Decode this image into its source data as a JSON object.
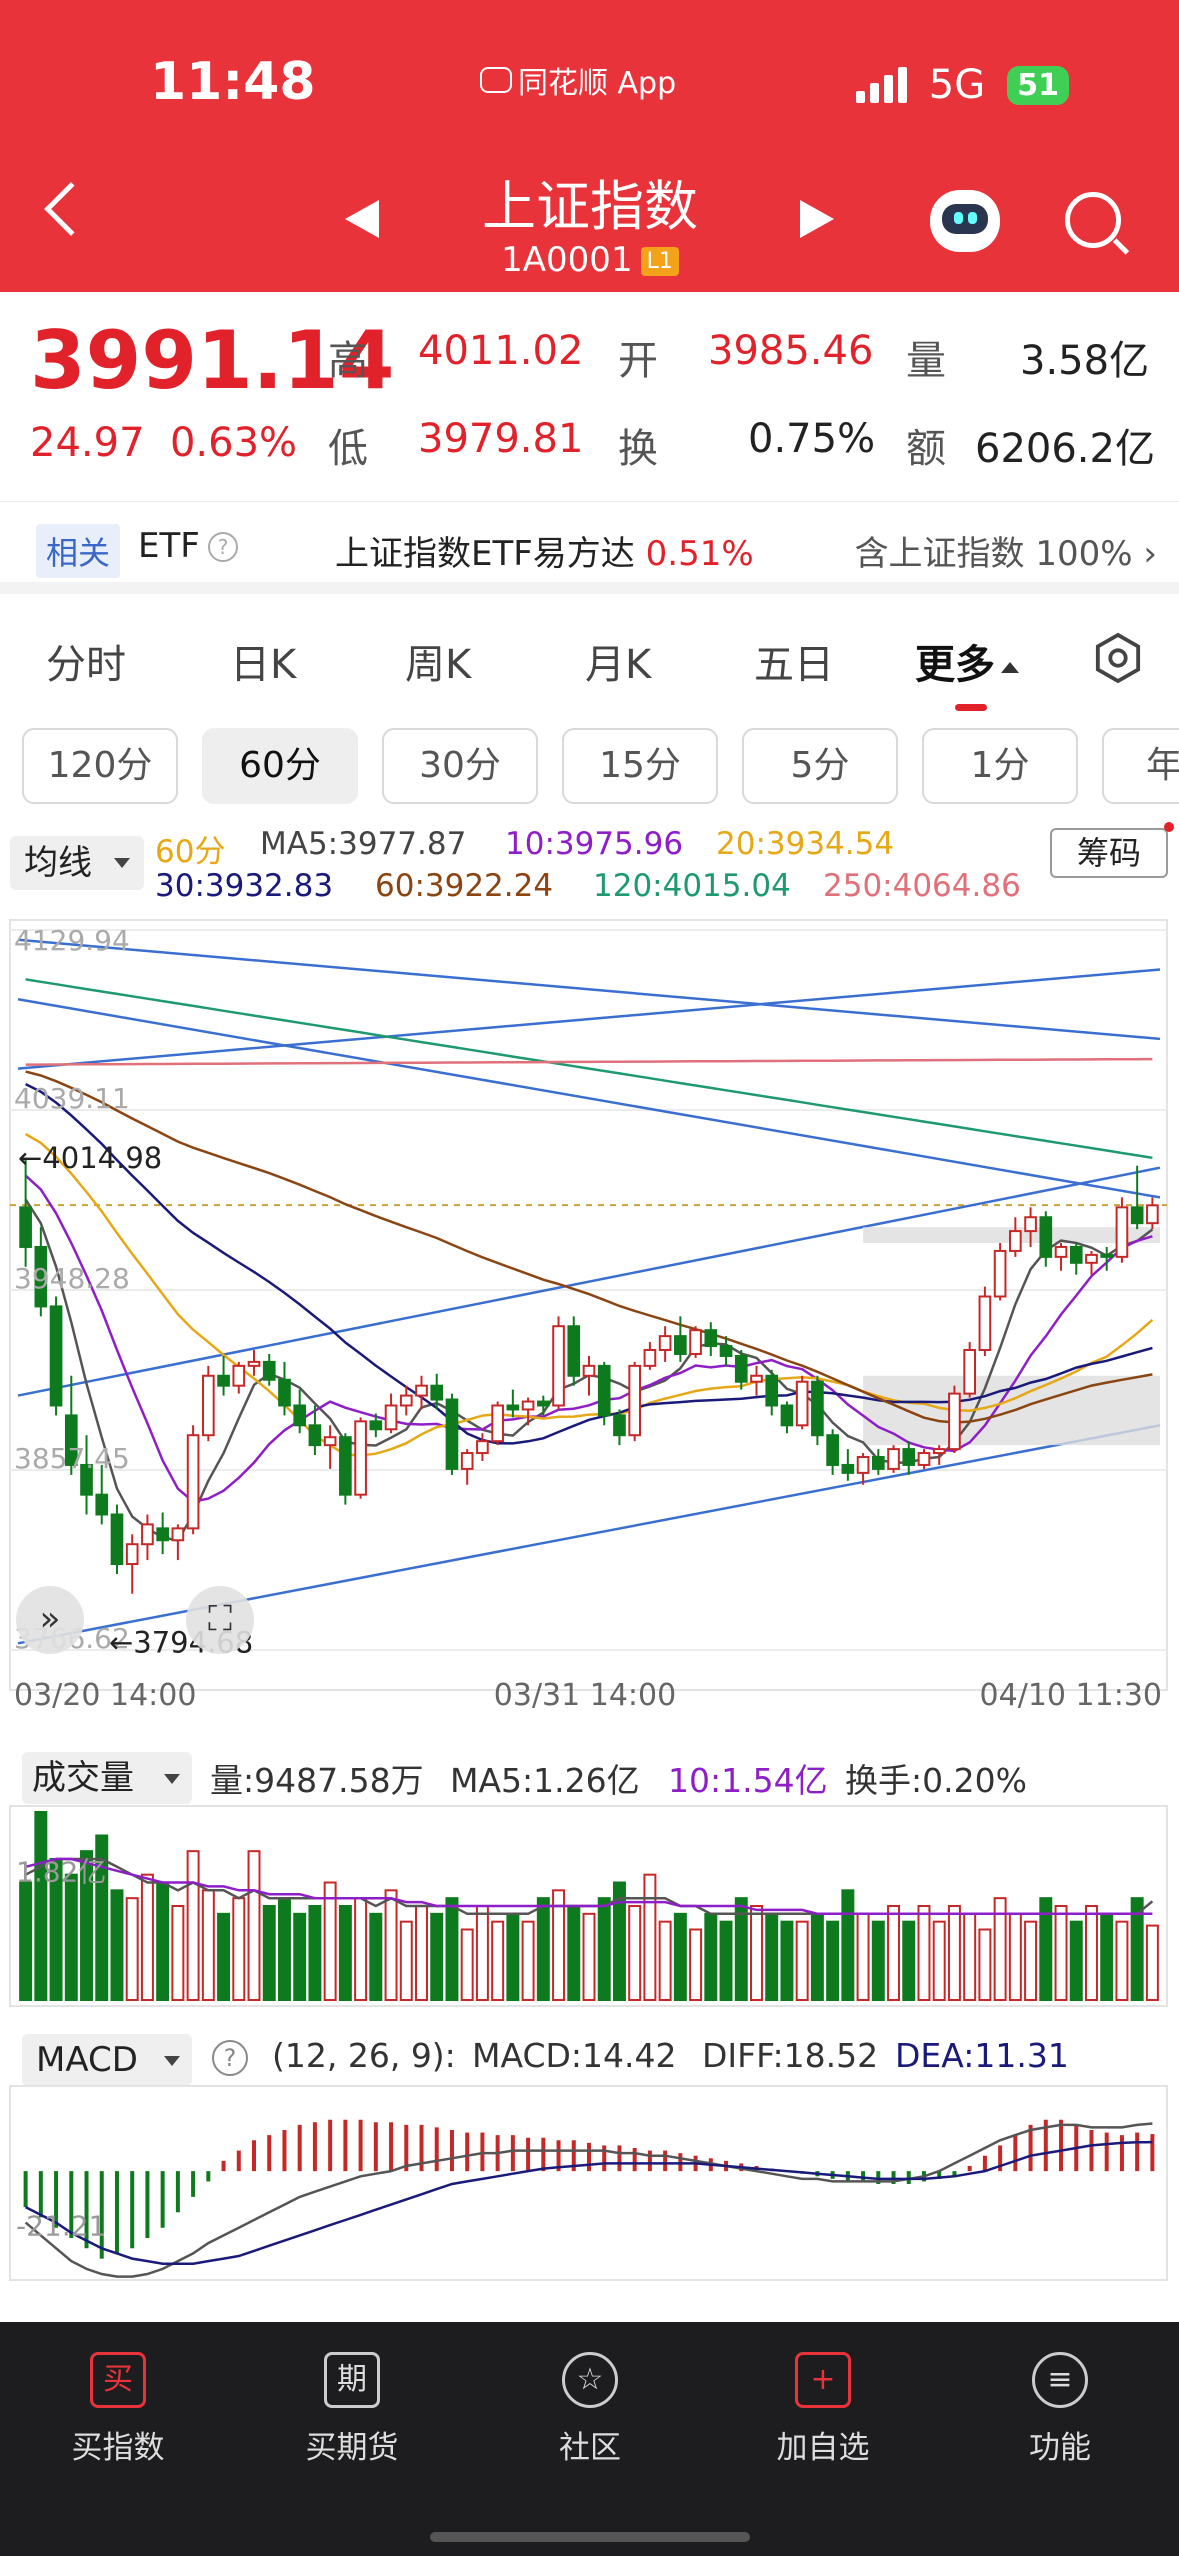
{
  "status_bar": {
    "time": "11:48",
    "app": "同花顺 App",
    "network": "5G",
    "battery": "51"
  },
  "header": {
    "title": "上证指数",
    "code": "1A0001",
    "badge": "L1"
  },
  "quote": {
    "price": "3991.14",
    "change": "24.97",
    "change_pct": "0.63%",
    "high_label": "高",
    "high": "4011.02",
    "open_label": "开",
    "open": "3985.46",
    "volume_label": "量",
    "volume": "3.58亿",
    "low_label": "低",
    "low": "3979.81",
    "turnover_label": "换",
    "turnover": "0.75%",
    "amount_label": "额",
    "amount": "6206.2亿"
  },
  "etf": {
    "tag": "相关",
    "name": "ETF",
    "fund": "上证指数ETF易方达",
    "fund_change": "0.51%",
    "holding": "含上证指数 100%",
    "chevron": "›"
  },
  "tabs": [
    {
      "label": "分时"
    },
    {
      "label": "日K"
    },
    {
      "label": "周K"
    },
    {
      "label": "月K"
    },
    {
      "label": "五日"
    },
    {
      "label": "更多"
    }
  ],
  "periods": [
    "120分",
    "60分",
    "30分",
    "15分",
    "5分",
    "1分",
    "年"
  ],
  "ma_legend": {
    "selector": "均线",
    "period": "60分",
    "ma5": "MA5:3977.87",
    "ma10": "10:3975.96",
    "ma20": "20:3934.54",
    "ma30": "30:3932.83",
    "ma60": "60:3922.24",
    "ma120": "120:4015.04",
    "ma250": "250:4064.86",
    "chips_button": "筹码"
  },
  "colors": {
    "up": "#c62828",
    "down": "#0e7a1e",
    "ma5": "#555555",
    "ma10": "#8e1fc8",
    "ma20": "#e6a817",
    "ma30": "#1a1a7a",
    "ma60": "#8b4513",
    "ma120": "#1e9a6e",
    "ma250": "#e0707a",
    "trend": "#3a6fd1"
  },
  "chart_data": [
    {
      "type": "candlestick",
      "ylim": [
        3766.62,
        4129.94
      ],
      "y_ticks": [
        "4129.94",
        "4039.11",
        "3948.28",
        "3857.45",
        "3766.62"
      ],
      "x_ticks": [
        "03/20 14:00",
        "03/31 14:00",
        "04/10 11:30"
      ],
      "annotations": {
        "high": "←4014.98",
        "low": "←3794.68"
      },
      "last_close": 3991.14,
      "candles": [
        [
          3990,
          4015,
          3960,
          3970
        ],
        [
          3970,
          3980,
          3935,
          3940
        ],
        [
          3940,
          3945,
          3885,
          3890
        ],
        [
          3885,
          3905,
          3855,
          3860
        ],
        [
          3860,
          3875,
          3835,
          3845
        ],
        [
          3845,
          3860,
          3830,
          3835
        ],
        [
          3835,
          3840,
          3805,
          3810
        ],
        [
          3810,
          3825,
          3795,
          3820
        ],
        [
          3820,
          3835,
          3812,
          3830
        ],
        [
          3828,
          3836,
          3815,
          3822
        ],
        [
          3822,
          3830,
          3812,
          3828
        ],
        [
          3828,
          3880,
          3825,
          3875
        ],
        [
          3875,
          3910,
          3872,
          3905
        ],
        [
          3905,
          3915,
          3895,
          3900
        ],
        [
          3900,
          3912,
          3896,
          3910
        ],
        [
          3910,
          3918,
          3905,
          3912
        ],
        [
          3912,
          3916,
          3900,
          3903
        ],
        [
          3903,
          3912,
          3885,
          3890
        ],
        [
          3890,
          3898,
          3876,
          3880
        ],
        [
          3880,
          3890,
          3865,
          3870
        ],
        [
          3870,
          3880,
          3858,
          3874
        ],
        [
          3874,
          3876,
          3840,
          3845
        ],
        [
          3845,
          3884,
          3843,
          3882
        ],
        [
          3882,
          3886,
          3874,
          3878
        ],
        [
          3878,
          3896,
          3876,
          3890
        ],
        [
          3890,
          3900,
          3885,
          3895
        ],
        [
          3895,
          3905,
          3888,
          3900
        ],
        [
          3900,
          3906,
          3888,
          3893
        ],
        [
          3893,
          3896,
          3855,
          3858
        ],
        [
          3858,
          3868,
          3850,
          3866
        ],
        [
          3866,
          3876,
          3862,
          3872
        ],
        [
          3872,
          3892,
          3870,
          3890
        ],
        [
          3890,
          3898,
          3884,
          3888
        ],
        [
          3888,
          3894,
          3880,
          3892
        ],
        [
          3892,
          3895,
          3885,
          3890
        ],
        [
          3890,
          3935,
          3888,
          3930
        ],
        [
          3930,
          3935,
          3900,
          3905
        ],
        [
          3905,
          3915,
          3895,
          3910
        ],
        [
          3910,
          3912,
          3880,
          3885
        ],
        [
          3885,
          3888,
          3870,
          3875
        ],
        [
          3875,
          3912,
          3872,
          3910
        ],
        [
          3910,
          3922,
          3908,
          3918
        ],
        [
          3918,
          3930,
          3912,
          3925
        ],
        [
          3925,
          3935,
          3912,
          3916
        ],
        [
          3916,
          3930,
          3914,
          3928
        ],
        [
          3928,
          3932,
          3915,
          3920
        ],
        [
          3920,
          3925,
          3910,
          3915
        ],
        [
          3915,
          3918,
          3898,
          3902
        ],
        [
          3902,
          3910,
          3895,
          3905
        ],
        [
          3905,
          3908,
          3885,
          3890
        ],
        [
          3890,
          3892,
          3876,
          3880
        ],
        [
          3880,
          3905,
          3878,
          3902
        ],
        [
          3902,
          3905,
          3870,
          3875
        ],
        [
          3875,
          3878,
          3855,
          3860
        ],
        [
          3860,
          3868,
          3852,
          3856
        ],
        [
          3856,
          3866,
          3850,
          3864
        ],
        [
          3864,
          3868,
          3855,
          3858
        ],
        [
          3858,
          3870,
          3856,
          3868
        ],
        [
          3868,
          3872,
          3855,
          3860
        ],
        [
          3860,
          3868,
          3858,
          3866
        ],
        [
          3866,
          3870,
          3860,
          3868
        ],
        [
          3868,
          3900,
          3866,
          3896
        ],
        [
          3896,
          3922,
          3894,
          3918
        ],
        [
          3918,
          3950,
          3915,
          3945
        ],
        [
          3945,
          3972,
          3943,
          3968
        ],
        [
          3968,
          3985,
          3965,
          3978
        ],
        [
          3978,
          3990,
          3970,
          3985
        ],
        [
          3985,
          3988,
          3960,
          3965
        ],
        [
          3965,
          3972,
          3958,
          3970
        ],
        [
          3970,
          3972,
          3956,
          3962
        ],
        [
          3962,
          3968,
          3956,
          3966
        ],
        [
          3966,
          3970,
          3958,
          3965
        ],
        [
          3965,
          3995,
          3962,
          3990
        ],
        [
          3990,
          4011,
          3979,
          3982
        ],
        [
          3982,
          3995,
          3979,
          3991
        ]
      ]
    },
    {
      "type": "bar",
      "title": "成交量",
      "volume_label": "量:9487.58万",
      "ma5": [
        1.6,
        1.7,
        1.8,
        1.8,
        1.8,
        1.8,
        1.7,
        1.6,
        1.5,
        1.5,
        1.4,
        1.5,
        1.4,
        1.4,
        1.3,
        1.4,
        1.3,
        1.3,
        1.3,
        1.3,
        1.3,
        1.3,
        1.3,
        1.2,
        1.3,
        1.2,
        1.2,
        1.2,
        1.2,
        1.1,
        1.1,
        1.1,
        1.1,
        1.1,
        1.2,
        1.2,
        1.2,
        1.2,
        1.2,
        1.3,
        1.3,
        1.3,
        1.3,
        1.2,
        1.2,
        1.1,
        1.1,
        1.1,
        1.1,
        1.1,
        1.1,
        1.1,
        1.1,
        1.1,
        1.1,
        1.1,
        1.1,
        1.1,
        1.1,
        1.1,
        1.1,
        1.1,
        1.1,
        1.1,
        1.1,
        1.1,
        1.1,
        1.1,
        1.1,
        1.1,
        1.1,
        1.1,
        1.1,
        1.1,
        1.26
      ],
      "ma10": [
        1.7,
        1.75,
        1.8,
        1.8,
        1.75,
        1.7,
        1.65,
        1.6,
        1.55,
        1.5,
        1.5,
        1.5,
        1.45,
        1.45,
        1.4,
        1.4,
        1.35,
        1.35,
        1.35,
        1.3,
        1.3,
        1.3,
        1.3,
        1.3,
        1.3,
        1.25,
        1.25,
        1.2,
        1.2,
        1.2,
        1.2,
        1.2,
        1.2,
        1.2,
        1.2,
        1.2,
        1.2,
        1.2,
        1.2,
        1.25,
        1.25,
        1.25,
        1.25,
        1.2,
        1.2,
        1.2,
        1.2,
        1.2,
        1.15,
        1.15,
        1.15,
        1.15,
        1.1,
        1.1,
        1.1,
        1.1,
        1.1,
        1.1,
        1.1,
        1.1,
        1.1,
        1.1,
        1.1,
        1.1,
        1.1,
        1.1,
        1.1,
        1.1,
        1.1,
        1.1,
        1.1,
        1.1,
        1.1,
        1.1,
        1.1
      ],
      "turnover": "换手:0.20%",
      "y_tick": "1.82亿",
      "ylim": [
        0,
        2.4
      ],
      "values": [
        1.5,
        2.4,
        1.8,
        1.6,
        1.9,
        2.1,
        1.4,
        1.3,
        1.6,
        1.5,
        1.2,
        1.9,
        1.4,
        1.1,
        1.3,
        1.9,
        1.2,
        1.3,
        1.1,
        1.2,
        1.5,
        1.2,
        1.3,
        1.1,
        1.4,
        1.0,
        1.2,
        1.1,
        1.3,
        0.9,
        1.2,
        1.0,
        1.1,
        1.0,
        1.3,
        1.4,
        1.2,
        1.1,
        1.3,
        1.5,
        1.2,
        1.6,
        1.0,
        1.1,
        0.9,
        1.1,
        1.0,
        1.3,
        1.2,
        1.1,
        1.0,
        1.0,
        1.1,
        1.0,
        1.4,
        1.1,
        1.0,
        1.2,
        1.0,
        1.2,
        1.0,
        1.2,
        1.1,
        0.9,
        1.3,
        1.1,
        1.0,
        1.3,
        1.2,
        1.0,
        1.2,
        1.1,
        1.0,
        1.3,
        0.95
      ]
    },
    {
      "type": "bar",
      "title": "MACD",
      "params": "(12, 26, 9):",
      "macd": "MACD:14.42",
      "diff": [
        -20,
        -25,
        -30,
        -35,
        -38,
        -40,
        -41,
        -41,
        -40,
        -38,
        -35,
        -32,
        -28,
        -25,
        -22,
        -19,
        -16,
        -13,
        -10,
        -8,
        -6,
        -4,
        -2,
        -1,
        0,
        2,
        3,
        4,
        5,
        6,
        7,
        7,
        8,
        8,
        8,
        8,
        8,
        8,
        8,
        7,
        7,
        6,
        6,
        5,
        4,
        3,
        2,
        1,
        0,
        -1,
        -2,
        -3,
        -3,
        -4,
        -4,
        -4,
        -4,
        -4,
        -3,
        -2,
        0,
        3,
        6,
        9,
        12,
        14,
        16,
        17,
        18,
        18,
        17,
        17,
        17,
        18,
        18.52
      ],
      "dea": [
        -14,
        -17,
        -20,
        -24,
        -27,
        -30,
        -32,
        -34,
        -35,
        -36,
        -36,
        -36,
        -35,
        -34,
        -33,
        -31,
        -29,
        -27,
        -25,
        -23,
        -21,
        -19,
        -17,
        -15,
        -13,
        -11,
        -9,
        -7,
        -5,
        -4,
        -3,
        -2,
        -1,
        0,
        1,
        1.5,
        2,
        2.5,
        3,
        3,
        3,
        3,
        3,
        3,
        3,
        2.5,
        2,
        1.5,
        1,
        0.5,
        0,
        -0.5,
        -1,
        -1.5,
        -2,
        -2.5,
        -3,
        -3,
        -3,
        -3,
        -2.5,
        -2,
        -1,
        0,
        2,
        4,
        6,
        7,
        8,
        9,
        10,
        10.5,
        11,
        11.2,
        11.31
      ],
      "y_tick": "-21.21",
      "ylim": [
        -40,
        30
      ],
      "values": [
        -14,
        -18,
        -22,
        -26,
        -30,
        -34,
        -32,
        -30,
        -26,
        -22,
        -16,
        -10,
        -4,
        4,
        8,
        12,
        14,
        16,
        18,
        19,
        20,
        20,
        20,
        19,
        19,
        18,
        18,
        17,
        16,
        15,
        15,
        14,
        14,
        13,
        13,
        12,
        12,
        11,
        10,
        10,
        9,
        8,
        8,
        7,
        6,
        5,
        4,
        3,
        2,
        1,
        0,
        -1,
        -2,
        -3,
        -4,
        -4,
        -5,
        -5,
        -5,
        -4,
        -3,
        -2,
        2,
        6,
        10,
        14,
        18,
        20,
        20,
        18,
        16,
        15,
        14,
        15,
        14.42
      ]
    }
  ],
  "volume_header": {
    "selector": "成交量",
    "volume": "量:9487.58万",
    "ma5": "MA5:1.26亿",
    "ma10": "10:1.54亿",
    "turnover": "换手:0.20%"
  },
  "macd_header": {
    "selector": "MACD",
    "params": "(12, 26, 9):",
    "macd": "MACD:14.42",
    "diff": "DIFF:18.52",
    "dea": "DEA:11.31",
    "help": "?"
  },
  "bottom_nav": [
    {
      "label": "买指数",
      "icon": "买"
    },
    {
      "label": "买期货",
      "icon": "期"
    },
    {
      "label": "社区",
      "icon": "☆"
    },
    {
      "label": "加自选",
      "icon": "+"
    },
    {
      "label": "功能",
      "icon": "≡"
    }
  ]
}
